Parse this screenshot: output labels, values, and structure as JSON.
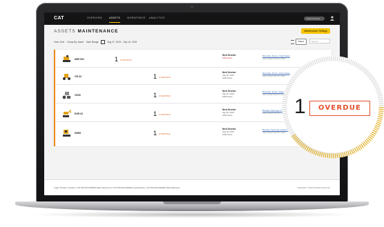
{
  "nav": {
    "logo": "CAT",
    "items": [
      "OVERVIEW",
      "ASSETS",
      "WORKFORCE",
      "ANALYTICS"
    ],
    "active": "ASSETS",
    "search_placeholder": "Search Assets"
  },
  "header": {
    "prefix": "ASSETS",
    "title": "MAINTENANCE",
    "settings_button": "Maintenance Settings"
  },
  "filters": {
    "view": "View: Grid",
    "group": "Group By: Asset",
    "date_range_label": "Date Range:",
    "date_range": "Aug 27, 2019 – Sep 10, 2019",
    "filters_button": "Filters",
    "search_placeholder": "Search"
  },
  "rows": [
    {
      "id": "D8R 001",
      "count": "1",
      "status": "OVERDUE",
      "service_hd": "Next Service:",
      "service_l1": "1000 Hours",
      "service_l2": "",
      "location": "Burnsville, Illinois, United States",
      "location_sub": "Last located Sep 06, 2019"
    },
    {
      "id": "CR-32",
      "count": "1",
      "status": "OVERDUE",
      "service_hd": "Next Service:",
      "service_l1": "Sep 30, 2019",
      "service_l2": "1000 Hours",
      "location": "Burnsville, Illinois, United States",
      "location_sub": "Last located Sep 06, 2019"
    },
    {
      "id": "CE33",
      "count": "1",
      "status": "OVERDUE",
      "service_hd": "Next Service:",
      "service_l1": "Sep 30, 2019",
      "service_l2": "1000 Hours",
      "location": "Burnsville, Illinois, United States",
      "location_sub": "Last located Sep 06, 2019"
    },
    {
      "id": "EXR 02",
      "count": "1",
      "status": "OVERDUE",
      "service_hd": "Next Service:",
      "service_l1": "Sep 30, 2019",
      "service_l2": "1000 Hours",
      "location": "Brooklyn, Wyoming, United States",
      "location_sub": "Last located Sep 06, 2019"
    },
    {
      "id": "D9R5",
      "count": "1",
      "status": "OVERDUE",
      "service_hd": "Next Service:",
      "service_l1": "Sep 30, 2019",
      "service_l2": "1000 Hours",
      "location": "Brooklyn, Wyoming, United States",
      "location_sub": "Last located Sep 06, 2019"
    }
  ],
  "footer": {
    "links": "Legal | Privacy | Cookies | CAT DIGITALOFFERS Entire Agreement | CAT DIGITALOFFERS Legal Notices | CAT DIGITALOFFERS Data Statement",
    "copyright": "Caterpillar © 2019 All Rights Reserved"
  },
  "callout": {
    "count": "1",
    "status": "OVERDUE"
  },
  "colors": {
    "accent_yellow": "#f5c400",
    "overdue": "#e3502b",
    "nav_bg": "#141414"
  }
}
